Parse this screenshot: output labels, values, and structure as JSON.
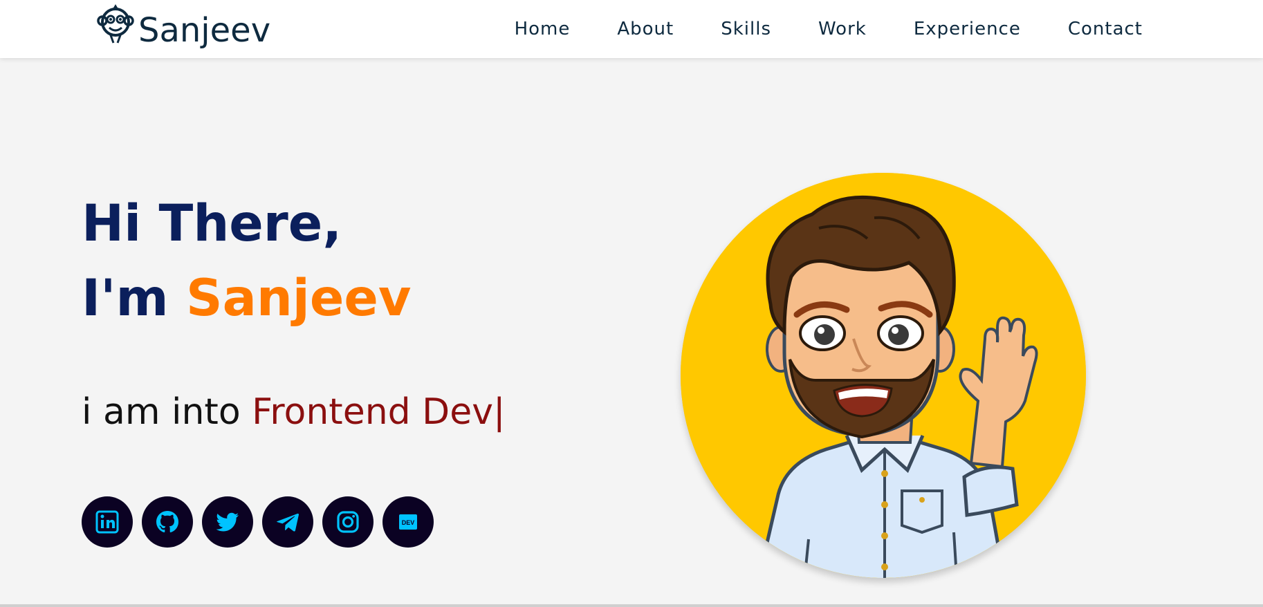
{
  "brand": {
    "name": "Sanjeev",
    "logo_icon": "monkey-logo-icon"
  },
  "nav": {
    "links": [
      "Home",
      "About",
      "Skills",
      "Work",
      "Experience",
      "Contact"
    ]
  },
  "hero": {
    "line1": "Hi There,",
    "line2_prefix": "I'm ",
    "line2_name": "Sanjeev",
    "typing_prefix": "i am into ",
    "typing_role": "Frontend Dev",
    "typing_cursor": "|",
    "avatar_icon": "avatar-illustration"
  },
  "socials": [
    {
      "icon": "linkedin-icon"
    },
    {
      "icon": "github-icon"
    },
    {
      "icon": "twitter-icon"
    },
    {
      "icon": "telegram-icon"
    },
    {
      "icon": "instagram-icon"
    },
    {
      "icon": "dev-icon",
      "text": "DEV"
    }
  ],
  "colors": {
    "heading": "#0b1f5c",
    "accent_name": "#ff7a00",
    "role": "#8b0f0f",
    "social_bg": "#0b0223",
    "social_icon": "#00c3ff",
    "avatar_bg": "#ffc800",
    "page_bg": "#f4f4f4"
  }
}
